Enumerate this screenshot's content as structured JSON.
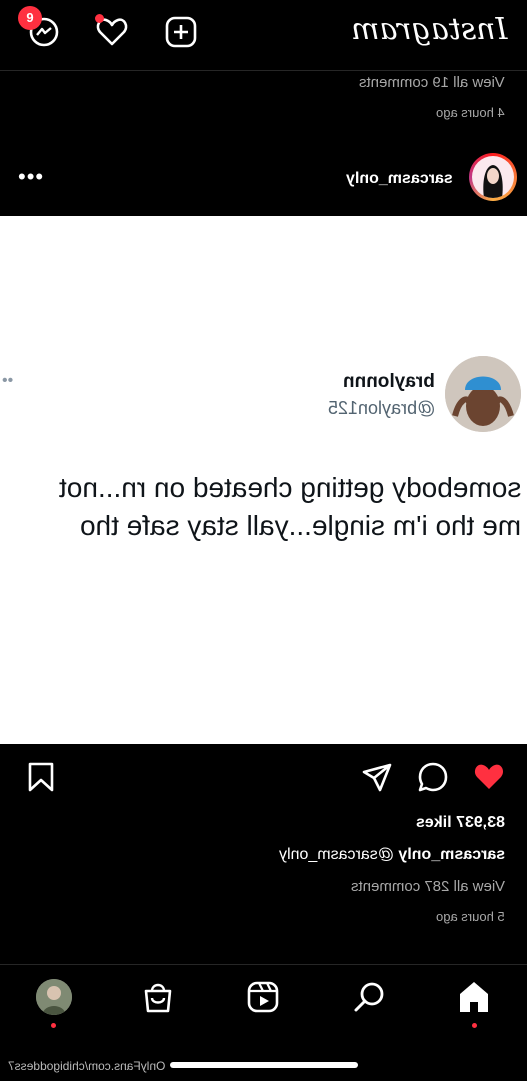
{
  "topbar": {
    "logo": "Instagram",
    "messages_badge": "9"
  },
  "post1": {
    "view_comments": "View all 19 comments",
    "time": "4 hours ago"
  },
  "post2": {
    "username": "sarcasm_only",
    "more": "•••",
    "tweet": {
      "name": "braylonnn",
      "handle": "@braylon125",
      "line1": "somebody getting cheated on rn...not",
      "line2": "me tho i'm single...yall stay safe tho",
      "more": "••"
    },
    "likes": "83,937 likes",
    "caption_user": "sarcasm_only",
    "caption_text": "@sarcasm_only",
    "view_comments": "View all 287 comments",
    "time": "5 hours ago"
  },
  "watermark": "OnlyFans.com/chibigoddess7",
  "colors": {
    "accent": "#ff3040",
    "muted": "#a8a8a8",
    "background": "#000000"
  }
}
